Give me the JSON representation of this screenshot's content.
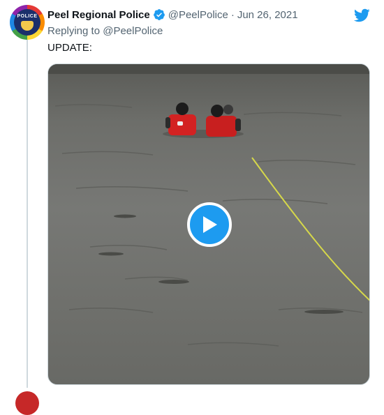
{
  "tweet": {
    "author_name": "Peel Regional Police",
    "handle": "@PeelPolice",
    "separator": "·",
    "date": "Jun 26, 2021",
    "replying_to": "Replying to @PeelPolice",
    "text": "UPDATE:",
    "avatar_label": "POLICE"
  },
  "icons": {
    "verified": "verified-badge-icon",
    "twitter": "twitter-bird-icon",
    "play": "play-icon"
  },
  "colors": {
    "accent": "#1d9bf0",
    "secondary_text": "#536471"
  }
}
